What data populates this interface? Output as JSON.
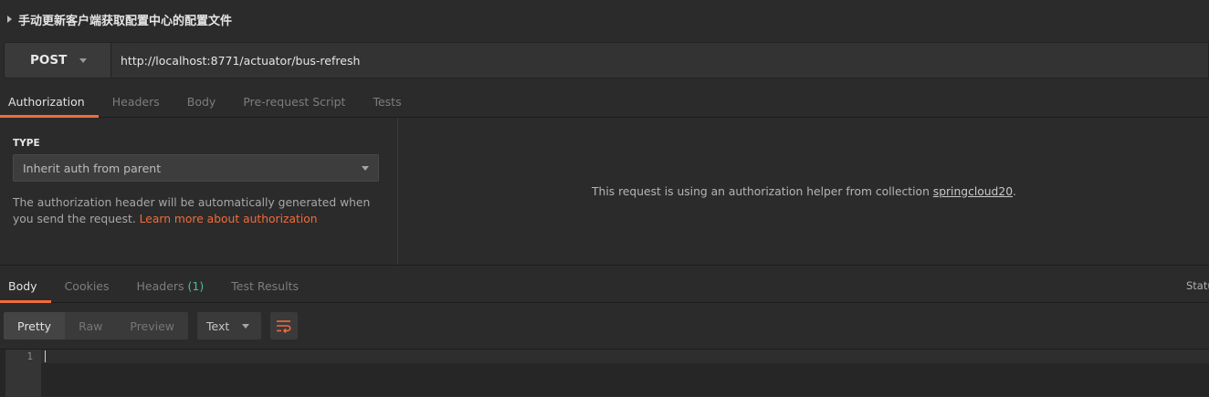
{
  "request": {
    "name": "手动更新客户端获取配置中心的配置文件",
    "method": "POST",
    "url": "http://localhost:8771/actuator/bus-refresh"
  },
  "request_tabs": [
    {
      "label": "Authorization",
      "active": true
    },
    {
      "label": "Headers",
      "active": false
    },
    {
      "label": "Body",
      "active": false
    },
    {
      "label": "Pre-request Script",
      "active": false
    },
    {
      "label": "Tests",
      "active": false
    }
  ],
  "auth": {
    "type_label": "TYPE",
    "selected_type": "Inherit auth from parent",
    "description": "The authorization header will be automatically generated when you send the request. ",
    "learn_link": "Learn more about authorization",
    "helper_prefix": "This request is using an authorization helper from collection ",
    "collection_name": "springcloud20",
    "helper_suffix": "."
  },
  "response_tabs": {
    "body": "Body",
    "cookies": "Cookies",
    "headers": "Headers",
    "headers_count": "(1)",
    "test_results": "Test Results"
  },
  "status_label": "Status",
  "response_toolbar": {
    "pretty": "Pretty",
    "raw": "Raw",
    "preview": "Preview",
    "format": "Text"
  },
  "editor": {
    "line_number": "1"
  },
  "colors": {
    "accent": "#f26b3a",
    "headers_count": "#4fb99f"
  },
  "icons": {
    "wrap": "wrap-lines-icon"
  }
}
